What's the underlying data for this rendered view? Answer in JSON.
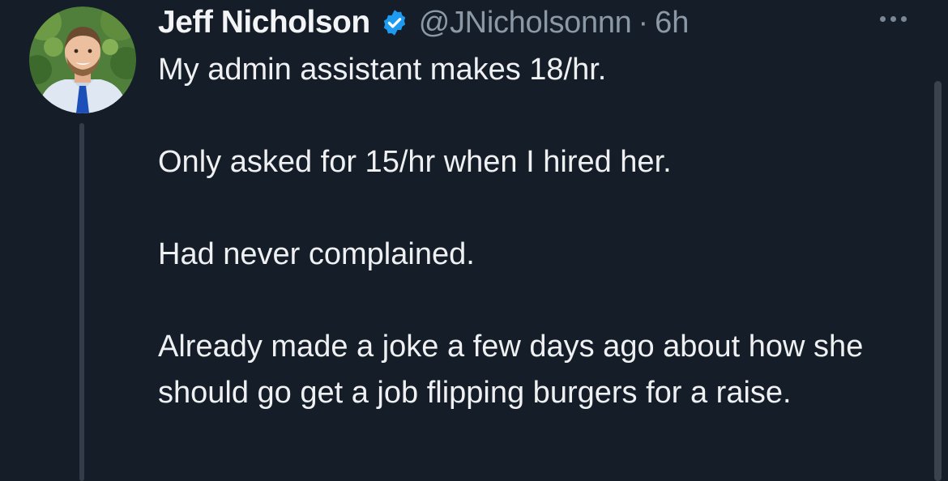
{
  "tweet": {
    "author": {
      "display_name": "Jeff Nicholson",
      "handle": "@JNicholsonnn",
      "verified": true,
      "avatar": "avatar-photo"
    },
    "separator": "·",
    "time": "6h",
    "more_icon": "more-horizontal-icon",
    "paragraphs": [
      "My admin assistant makes 18/hr.",
      "Only asked for 15/hr when I hired her.",
      "Had never complained.",
      "Already made a joke a few days ago about how she should go get a job flipping burgers for a raise."
    ]
  },
  "colors": {
    "background": "#151d28",
    "text": "#e7e9ea",
    "muted": "#8b98a5",
    "verified_badge": "#1d9bf0",
    "thread_line": "#333c48"
  }
}
